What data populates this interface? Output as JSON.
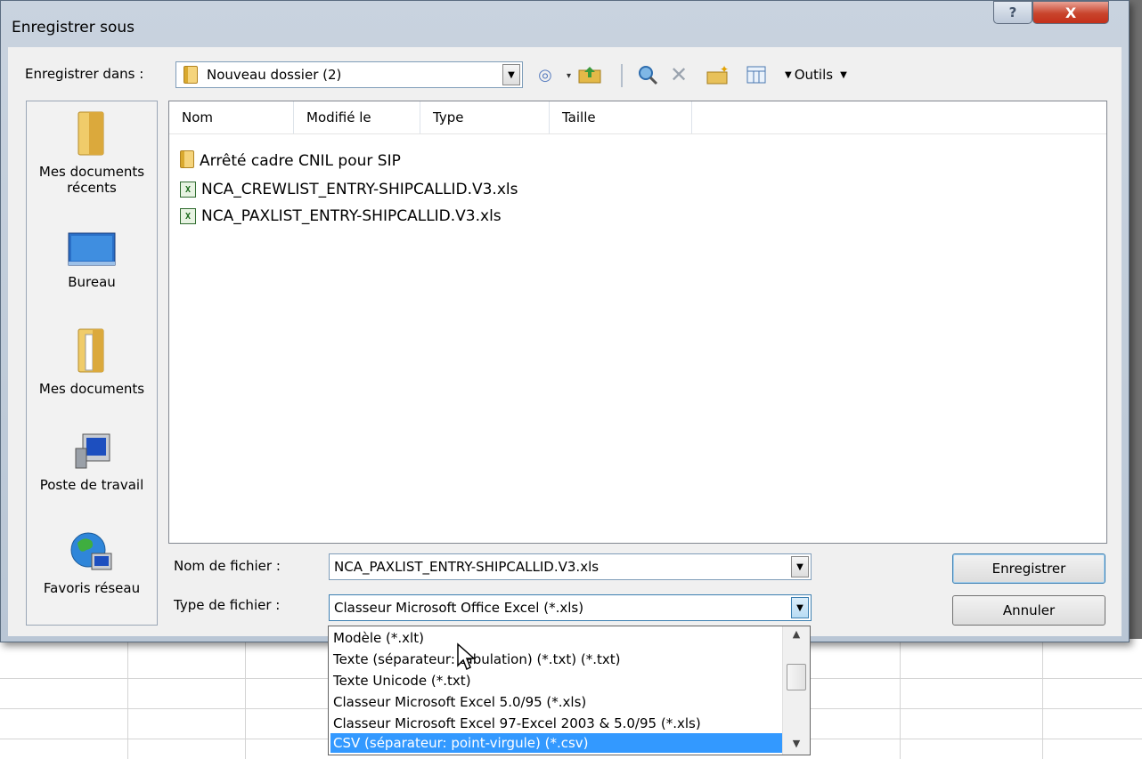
{
  "dialog": {
    "title": "Enregistrer sous",
    "help_label": "?",
    "close_label": "X"
  },
  "toolbar": {
    "save_in_label": "Enregistrer dans :",
    "location": "Nouveau dossier (2)",
    "tools_label": "Outils"
  },
  "places": [
    {
      "label_line1": "Mes documents",
      "label_line2": "récents"
    },
    {
      "label_line1": "Bureau",
      "label_line2": ""
    },
    {
      "label_line1": "Mes documents",
      "label_line2": ""
    },
    {
      "label_line1": "Poste de travail",
      "label_line2": ""
    },
    {
      "label_line1": "Favoris réseau",
      "label_line2": ""
    }
  ],
  "file_list": {
    "columns": [
      "Nom",
      "Modifié le",
      "Type",
      "Taille"
    ],
    "items": [
      {
        "name": "Arrêté cadre CNIL pour SIP",
        "kind": "folder"
      },
      {
        "name": "NCA_CREWLIST_ENTRY-SHIPCALLID.V3.xls",
        "kind": "excel"
      },
      {
        "name": "NCA_PAXLIST_ENTRY-SHIPCALLID.V3.xls",
        "kind": "excel"
      }
    ]
  },
  "form": {
    "filename_label": "Nom de fichier :",
    "filename_value": "NCA_PAXLIST_ENTRY-SHIPCALLID.V3.xls",
    "filetype_label": "Type de fichier :",
    "filetype_value": "Classeur Microsoft Office Excel (*.xls)"
  },
  "buttons": {
    "save": "Enregistrer",
    "cancel": "Annuler"
  },
  "filetype_options": [
    "Modèle (*.xlt)",
    "Texte (séparateur: tabulation) (*.txt) (*.txt)",
    "Texte Unicode (*.txt)",
    "Classeur Microsoft Excel 5.0/95 (*.xls)",
    "Classeur Microsoft Excel 97-Excel 2003 & 5.0/95 (*.xls)",
    "CSV (séparateur: point-virgule) (*.csv)"
  ],
  "selected_option_index": 5,
  "colors": {
    "selection": "#3399ff",
    "dialog_frame": "#c9d3df",
    "close_button": "#c8442c"
  }
}
